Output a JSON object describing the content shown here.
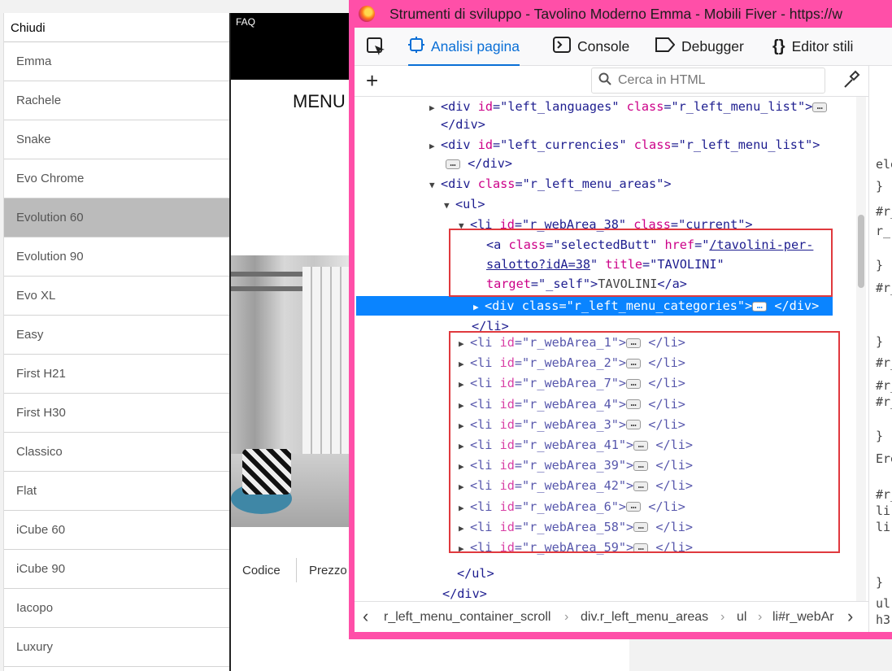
{
  "side_menu": {
    "close_label": "Chiudi",
    "items": [
      "Emma",
      "Rachele",
      "Snake",
      "Evo Chrome",
      "Evolution 60",
      "Evolution 90",
      "Evo XL",
      "Easy",
      "First H21",
      "First H30",
      "Classico",
      "Flat",
      "iCube 60",
      "iCube 90",
      "Iacopo",
      "Luxury"
    ],
    "selected": "Evolution 60"
  },
  "site": {
    "faq_label": "FAQ",
    "menu_label": "MENU",
    "tab_code": "Codice",
    "tab_price": "Prezzo"
  },
  "devtools": {
    "title": "Strumenti di sviluppo - Tavolino Moderno Emma - Mobili Fiver - https://w",
    "tabs": {
      "inspector": "Analisi pagina",
      "console": "Console",
      "debugger": "Debugger",
      "style_editor": "Editor stili"
    },
    "search_placeholder": "Cerca in HTML",
    "breadcrumbs": [
      "r_left_menu_container_scroll",
      "div.r_left_menu_areas",
      "ul",
      "li#r_webAr"
    ],
    "rules_snippets": [
      "ele",
      "}",
      "#r_",
      "r_",
      "}",
      "#r_",
      "}",
      "#r_",
      "#r_",
      "#r_",
      "}",
      "Ere",
      "#r_",
      "li",
      "li",
      "}",
      "ul",
      "h3"
    ],
    "accent_color": "#0a6fd6",
    "frame_color": "#ff4fa8"
  },
  "markup": {
    "l1_id": "left_languages",
    "l1_class": "r_left_menu_list",
    "l3_id": "left_currencies",
    "l3_class": "r_left_menu_list",
    "l5_class": "r_left_menu_areas",
    "l7_id": "r_webArea_38",
    "l7_class": "current",
    "a_class": "selectedButt",
    "a_href_1": "/tavolini-per-",
    "a_href_2": "salotto?idA=38",
    "a_title": "TAVOLINI",
    "a_target": "_self",
    "a_text": "TAVOLINI",
    "sel_class": "r_left_menu_categories",
    "li_ids": [
      "r_webArea_1",
      "r_webArea_2",
      "r_webArea_7",
      "r_webArea_4",
      "r_webArea_3",
      "r_webArea_41",
      "r_webArea_39",
      "r_webArea_42",
      "r_webArea_6",
      "r_webArea_58",
      "r_webArea_59"
    ]
  }
}
